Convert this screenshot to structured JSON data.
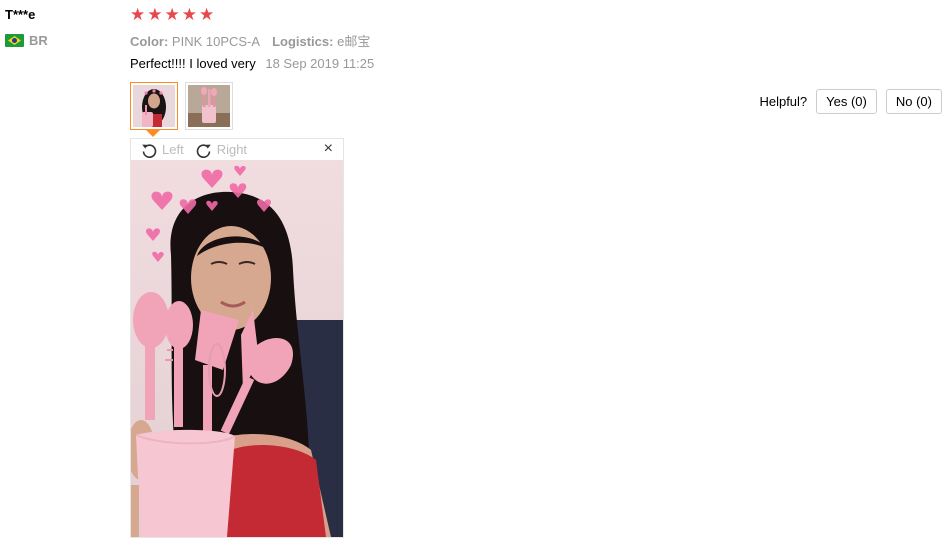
{
  "review": {
    "user_name": "T***e",
    "country_code": "BR",
    "flag_icon": "brazil-flag-icon",
    "rating": 5,
    "stars": [
      "★",
      "★",
      "★",
      "★",
      "★"
    ],
    "color_label": "Color:",
    "color_value": "PINK 10PCS-A",
    "logistics_label": "Logistics:",
    "logistics_value": "e邮宝",
    "feedback_text": "Perfect!!!! I loved very",
    "date": "18 Sep 2019 11:25"
  },
  "viewer": {
    "rotate_left_label": "Left",
    "rotate_right_label": "Right",
    "close_glyph": "×"
  },
  "helpful": {
    "label": "Helpful?",
    "yes_label": "Yes (0)",
    "no_label": "No (0)"
  },
  "colors": {
    "star": "#e8484c",
    "active_thumb_border": "#ff8b25",
    "muted_text": "#999999"
  }
}
